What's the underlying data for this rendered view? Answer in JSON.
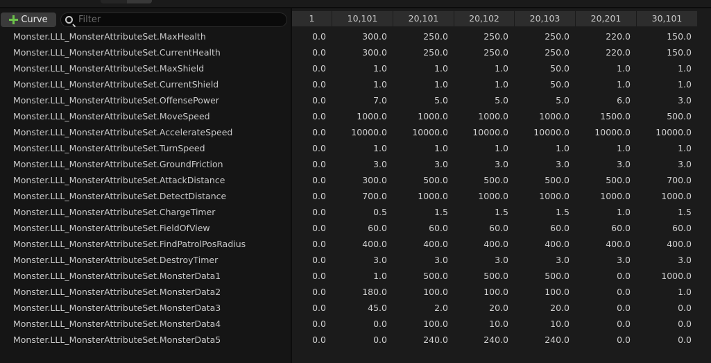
{
  "toolbar": {
    "curve_button_label": "Curve",
    "filter_placeholder": "Filter",
    "filter_value": ""
  },
  "columns": [
    "1",
    "10,101",
    "20,101",
    "20,102",
    "20,103",
    "20,201",
    "30,101"
  ],
  "rows": [
    {
      "name": "Monster.LLL_MonsterAttributeSet.MaxHealth",
      "values": [
        "0.0",
        "300.0",
        "250.0",
        "250.0",
        "250.0",
        "220.0",
        "150.0"
      ]
    },
    {
      "name": "Monster.LLL_MonsterAttributeSet.CurrentHealth",
      "values": [
        "0.0",
        "300.0",
        "250.0",
        "250.0",
        "250.0",
        "220.0",
        "150.0"
      ]
    },
    {
      "name": "Monster.LLL_MonsterAttributeSet.MaxShield",
      "values": [
        "0.0",
        "1.0",
        "1.0",
        "1.0",
        "50.0",
        "1.0",
        "1.0"
      ]
    },
    {
      "name": "Monster.LLL_MonsterAttributeSet.CurrentShield",
      "values": [
        "0.0",
        "1.0",
        "1.0",
        "1.0",
        "50.0",
        "1.0",
        "1.0"
      ]
    },
    {
      "name": "Monster.LLL_MonsterAttributeSet.OffensePower",
      "values": [
        "0.0",
        "7.0",
        "5.0",
        "5.0",
        "5.0",
        "6.0",
        "3.0"
      ]
    },
    {
      "name": "Monster.LLL_MonsterAttributeSet.MoveSpeed",
      "values": [
        "0.0",
        "1000.0",
        "1000.0",
        "1000.0",
        "1000.0",
        "1500.0",
        "500.0"
      ]
    },
    {
      "name": "Monster.LLL_MonsterAttributeSet.AccelerateSpeed",
      "values": [
        "0.0",
        "10000.0",
        "10000.0",
        "10000.0",
        "10000.0",
        "10000.0",
        "10000.0"
      ]
    },
    {
      "name": "Monster.LLL_MonsterAttributeSet.TurnSpeed",
      "values": [
        "0.0",
        "1.0",
        "1.0",
        "1.0",
        "1.0",
        "1.0",
        "1.0"
      ]
    },
    {
      "name": "Monster.LLL_MonsterAttributeSet.GroundFriction",
      "values": [
        "0.0",
        "3.0",
        "3.0",
        "3.0",
        "3.0",
        "3.0",
        "3.0"
      ]
    },
    {
      "name": "Monster.LLL_MonsterAttributeSet.AttackDistance",
      "values": [
        "0.0",
        "300.0",
        "500.0",
        "500.0",
        "500.0",
        "500.0",
        "700.0"
      ]
    },
    {
      "name": "Monster.LLL_MonsterAttributeSet.DetectDistance",
      "values": [
        "0.0",
        "700.0",
        "1000.0",
        "1000.0",
        "1000.0",
        "1000.0",
        "1000.0"
      ]
    },
    {
      "name": "Monster.LLL_MonsterAttributeSet.ChargeTimer",
      "values": [
        "0.0",
        "0.5",
        "1.5",
        "1.5",
        "1.5",
        "1.0",
        "1.5"
      ]
    },
    {
      "name": "Monster.LLL_MonsterAttributeSet.FieldOfView",
      "values": [
        "0.0",
        "60.0",
        "60.0",
        "60.0",
        "60.0",
        "60.0",
        "60.0"
      ]
    },
    {
      "name": "Monster.LLL_MonsterAttributeSet.FindPatrolPosRadius",
      "values": [
        "0.0",
        "400.0",
        "400.0",
        "400.0",
        "400.0",
        "400.0",
        "400.0"
      ]
    },
    {
      "name": "Monster.LLL_MonsterAttributeSet.DestroyTimer",
      "values": [
        "0.0",
        "3.0",
        "3.0",
        "3.0",
        "3.0",
        "3.0",
        "3.0"
      ]
    },
    {
      "name": "Monster.LLL_MonsterAttributeSet.MonsterData1",
      "values": [
        "0.0",
        "1.0",
        "500.0",
        "500.0",
        "500.0",
        "0.0",
        "1000.0"
      ]
    },
    {
      "name": "Monster.LLL_MonsterAttributeSet.MonsterData2",
      "values": [
        "0.0",
        "180.0",
        "100.0",
        "100.0",
        "100.0",
        "0.0",
        "1.0"
      ]
    },
    {
      "name": "Monster.LLL_MonsterAttributeSet.MonsterData3",
      "values": [
        "0.0",
        "45.0",
        "2.0",
        "20.0",
        "20.0",
        "0.0",
        "0.0"
      ]
    },
    {
      "name": "Monster.LLL_MonsterAttributeSet.MonsterData4",
      "values": [
        "0.0",
        "0.0",
        "100.0",
        "10.0",
        "10.0",
        "0.0",
        "0.0"
      ]
    },
    {
      "name": "Monster.LLL_MonsterAttributeSet.MonsterData5",
      "values": [
        "0.0",
        "0.0",
        "240.0",
        "240.0",
        "240.0",
        "0.0",
        "0.0"
      ]
    }
  ]
}
